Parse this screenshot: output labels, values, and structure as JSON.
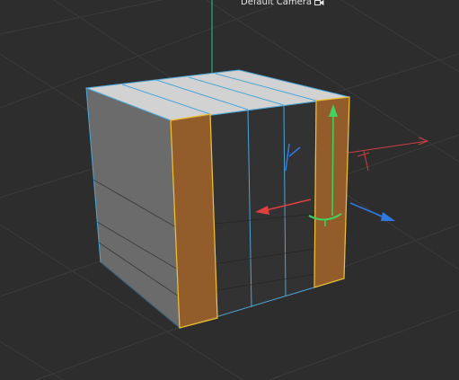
{
  "viewport": {
    "camera_name": "Default Camera",
    "camera_icon": "camera-icon",
    "background_color": "#2d2d2d",
    "grid_color": "#3b3b3b"
  },
  "object": {
    "type": "cube",
    "top_face_color": "#d2d2d2",
    "left_face_color": "#6b6b6b",
    "front_face_color": "#323232",
    "edge_color": "#4da6d8",
    "selected_polygon_fill": "#a5642a",
    "selected_polygon_edge": "#f0c030"
  },
  "gizmo": {
    "x_axis_color": "#e04040",
    "y_axis_color": "#3fd35f",
    "z_axis_color": "#2f7ae0",
    "world_y_axis_color": "#2ec27e"
  }
}
